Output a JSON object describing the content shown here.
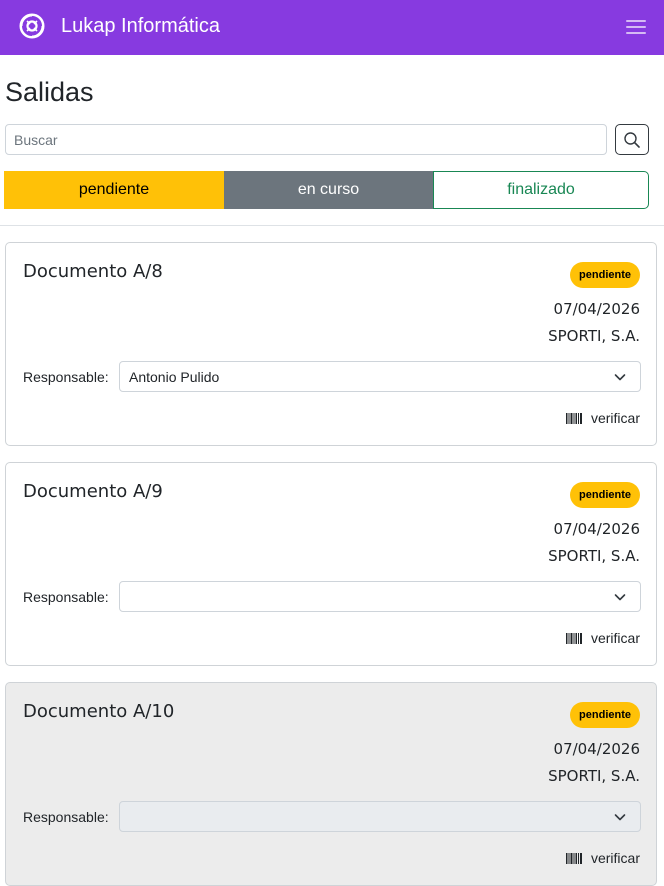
{
  "header": {
    "brand": "Lukap Informática",
    "logo_icon": "lukap-logo-icon",
    "menu_icon": "hamburger-menu-icon",
    "color": "#873ae0"
  },
  "page": {
    "title": "Salidas"
  },
  "search": {
    "placeholder": "Buscar",
    "value": "",
    "icon": "search-icon"
  },
  "status_tabs": [
    {
      "label": "pendiente",
      "color": "#ffc107",
      "active": true
    },
    {
      "label": "en curso",
      "color": "#6c757d"
    },
    {
      "label": "finalizado",
      "color": "#198754"
    }
  ],
  "documents": [
    {
      "title": "Documento A/8",
      "status": "pendiente",
      "date": "07/04/2026",
      "client": "SPORTI, S.A.",
      "responsable_label": "Responsable:",
      "responsable_value": "Antonio Pulido",
      "verify_label": "verificar",
      "disabled": false
    },
    {
      "title": "Documento A/9",
      "status": "pendiente",
      "date": "07/04/2026",
      "client": "SPORTI, S.A.",
      "responsable_label": "Responsable:",
      "responsable_value": "",
      "verify_label": "verificar",
      "disabled": false
    },
    {
      "title": "Documento A/10",
      "status": "pendiente",
      "date": "07/04/2026",
      "client": "SPORTI, S.A.",
      "responsable_label": "Responsable:",
      "responsable_value": "",
      "verify_label": "verificar",
      "disabled": true
    }
  ]
}
